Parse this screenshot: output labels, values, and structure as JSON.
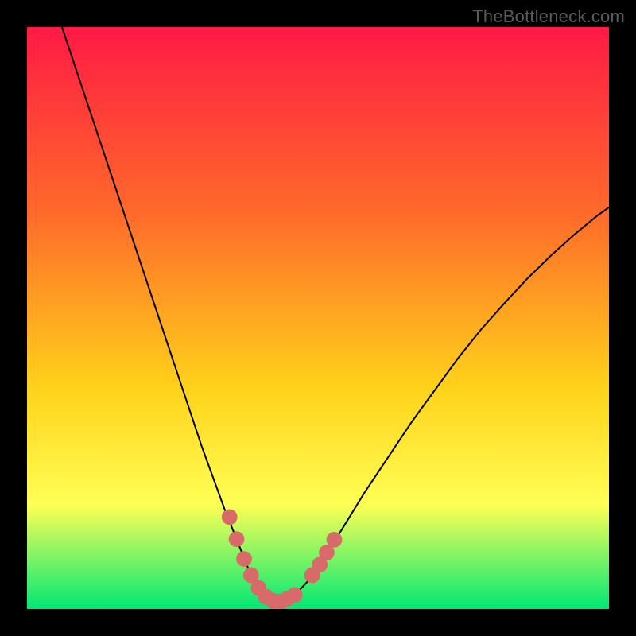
{
  "attribution": "TheBottleneck.com",
  "colors": {
    "frame_bg": "#000000",
    "grad_top": "#ff1a44",
    "grad_mid1": "#ff6a2a",
    "grad_mid2": "#ffd21a",
    "grad_mid3": "#ffff55",
    "grad_bot": "#00e874",
    "curve": "#000000",
    "marker": "#d86a6a"
  },
  "chart_data": {
    "type": "line",
    "title": "",
    "xlabel": "",
    "ylabel": "",
    "xlim": [
      0,
      100
    ],
    "ylim": [
      0,
      100
    ],
    "grid": false,
    "legend": false,
    "series": [
      {
        "name": "curve",
        "x": [
          6,
          8,
          10,
          12,
          14,
          16,
          18,
          20,
          22,
          24,
          26,
          28,
          30,
          32,
          34,
          35,
          36,
          37,
          38,
          39,
          40,
          41,
          42,
          43,
          44,
          46,
          48,
          50,
          54,
          58,
          62,
          66,
          70,
          74,
          78,
          82,
          86,
          90,
          94,
          98,
          100
        ],
        "y": [
          100,
          94,
          88,
          82,
          76,
          70,
          64,
          58,
          52,
          46,
          40,
          34,
          28,
          22.5,
          17,
          14.5,
          12,
          9.5,
          7,
          5,
          3.3,
          2.1,
          1.4,
          1.2,
          1.4,
          2.4,
          4.5,
          7.2,
          13.5,
          20,
          26,
          32,
          37.5,
          43,
          48,
          52.5,
          56.8,
          60.7,
          64.3,
          67.6,
          69
        ]
      }
    ],
    "markers": {
      "name": "highlight-dots",
      "color": "#d86a6a",
      "points": [
        {
          "x": 34.8,
          "y": 15.8
        },
        {
          "x": 36.0,
          "y": 12.0
        },
        {
          "x": 37.3,
          "y": 8.6
        },
        {
          "x": 38.5,
          "y": 5.8
        },
        {
          "x": 39.8,
          "y": 3.6
        },
        {
          "x": 41.0,
          "y": 2.1
        },
        {
          "x": 42.3,
          "y": 1.4
        },
        {
          "x": 43.6,
          "y": 1.3
        },
        {
          "x": 44.8,
          "y": 1.8
        },
        {
          "x": 46.0,
          "y": 2.4
        },
        {
          "x": 49.0,
          "y": 5.8
        },
        {
          "x": 50.3,
          "y": 7.6
        },
        {
          "x": 51.5,
          "y": 9.7
        },
        {
          "x": 52.8,
          "y": 11.9
        }
      ]
    }
  }
}
